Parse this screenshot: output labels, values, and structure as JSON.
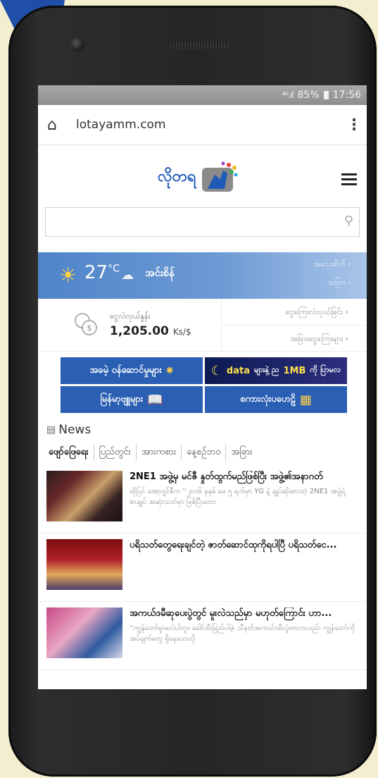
{
  "status_bar": {
    "signal": "⁴ᴳ.ıl",
    "battery": "85%",
    "time": "17:56"
  },
  "browser": {
    "url": "lotayamm.com"
  },
  "header": {
    "logo_text": "လိုတရ"
  },
  "search": {
    "placeholder": ""
  },
  "weather": {
    "temperature": "27",
    "unit": "°C",
    "city": "အင်းစိန်",
    "link_details": "အသေးစိတ် ›",
    "link_other": "အခြား ›"
  },
  "currency": {
    "label": "ငွေလဲလှယ်နှုန်း",
    "value": "1,205.00",
    "unit": "Ks/$",
    "link_transfer": "ငွေကြေးလဲလှယ်ခြင်း ›",
    "link_other": "အခြားငွေကြေးများ ›"
  },
  "banners": [
    {
      "label": "အခမဲ့ ဝန်ဆောင်မှုများ"
    },
    {
      "label_a": "data",
      "label_b": "များနဲ့ ည",
      "label_c": "1MB",
      "label_d": "ကို ပြာမလ"
    },
    {
      "label": "မြန်မာ့ဗျူများ"
    },
    {
      "label": "စကားလုံးပဟေဠိ"
    }
  ],
  "news": {
    "heading": "News",
    "tabs": [
      "ဖျော်ဖြေရေး",
      "ပြည်တွင်း",
      "အားကစား",
      "နေ့စဉ်ဘဝ",
      "အခြား"
    ],
    "items": [
      {
        "title": "2NE1 အဖွဲ့မှ မင်ဇီ နှုတ်ထွက်မည်ဖြစ်ပြီး အဖွဲ့၏အနာဂတ်",
        "snippet": "ထိုပြင် အော့ဂျင်စီက ''၂၀၁၆ ခုနှစ် မေ ၅ ရက်မှာ YG နဲ့ ချုပ်ဆိုထားတဲ့ 2NE1 အဖွဲ့ရဲ့ စာချုပ် အဆုံးသတ်မှာ ဖြစ်ပြီးတော"
      },
      {
        "title": "ပရိသတ်တွေရေးချင်တဲ့ ဇာတ်ဆောင်ထုကိုရပါပြီ ပရိသတ်ငေ...",
        "snippet": ""
      },
      {
        "title": "အကယ်ဒမီဆုပေးပွဲတွင် မူးလဲသည်မှာ မဟုတ်ကြောင်း ဟာ...",
        "snippet": "''ကျွန်တော်မူးမလဲပါဘူး၊ ခေါင်းမီးမြည်ပါမဲ့၊ သီနတ်အကယ်ဒမီလွဲတာကလည်း ကျွန်တော်ကိုအပ်ချက်တွေ ရှိနေသေးလို"
      }
    ]
  }
}
